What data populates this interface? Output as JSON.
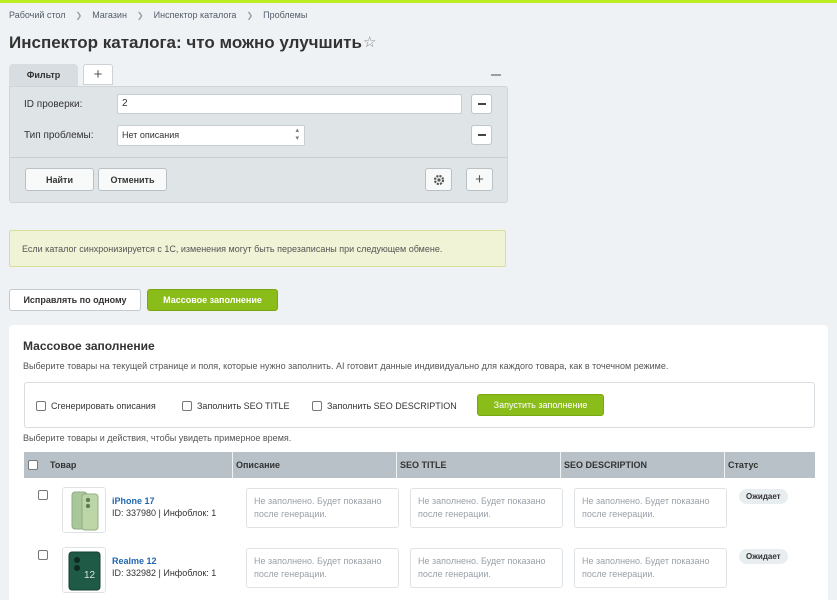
{
  "breadcrumb": [
    "Рабочий стол",
    "Магазин",
    "Инспектор каталога",
    "Проблемы"
  ],
  "page_title": "Инспектор каталога: что можно улучшить",
  "filter": {
    "tab_label": "Фильтр",
    "fields": [
      {
        "label": "ID проверки:",
        "value": "2"
      },
      {
        "label": "Тип проблемы:",
        "value": "Нет описания"
      }
    ],
    "find_button": "Найти",
    "cancel_button": "Отменить"
  },
  "notice": "Если каталог синхронизируется с 1С, изменения могут быть перезаписаны при следующем обмене.",
  "modes": {
    "one_by_one": "Исправлять по одному",
    "mass_fill": "Массовое заполнение"
  },
  "mass": {
    "title": "Массовое заполнение",
    "description": "Выберите товары на текущей странице и поля, которые нужно заполнить. AI готовит данные индивидуально для каждого товара, как в точечном режиме.",
    "options": [
      "Сгенерировать описания",
      "Заполнить SEO TITLE",
      "Заполнить SEO DESCRIPTION"
    ],
    "run_button": "Запустить заполнение",
    "hint": "Выберите товары и действия, чтобы увидеть примерное время."
  },
  "table": {
    "columns": [
      "Товар",
      "Описание",
      "SEO TITLE",
      "SEO DESCRIPTION",
      "Статус"
    ],
    "placeholder": "Не заполнено. Будет показано после генерации.",
    "rows": [
      {
        "name": "iPhone 17",
        "id_line": "ID: 337980 | Инфоблок: 1",
        "status": "Ожидает"
      },
      {
        "name": "Realme 12",
        "id_line": "ID: 332982 | Инфоблок: 1",
        "status": "Ожидает"
      }
    ]
  },
  "colors": {
    "accent_green": "#8bbd1a",
    "top_line": "#bbed21",
    "link_blue": "#2067b0"
  },
  "icons": [
    "star-icon",
    "plus-icon",
    "minus-icon",
    "gear-icon",
    "select-arrows-icon"
  ]
}
